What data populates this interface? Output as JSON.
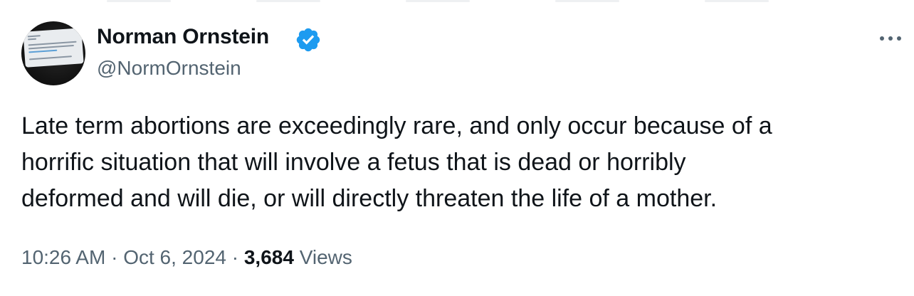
{
  "author": {
    "name": "Norman Ornstein",
    "handle": "@NormOrnstein",
    "verified_icon": "verified-badge-icon",
    "verified_color": "#1d9bf0"
  },
  "tweet": {
    "text_lines": [
      "Late term abortions are exceedingly rare, and only occur because of a",
      "horrific situation that will involve a fetus that is dead or horribly",
      "deformed and will die, or will directly threaten the life of a mother."
    ]
  },
  "meta": {
    "time": "10:26 AM",
    "separator": "·",
    "date": "Oct 6, 2024",
    "views_count": "3,684",
    "views_label": "Views"
  },
  "icons": {
    "more": "more-options-icon",
    "avatar": "avatar"
  },
  "colors": {
    "text_primary": "#0f1419",
    "text_secondary": "#536471",
    "accent": "#1d9bf0"
  }
}
